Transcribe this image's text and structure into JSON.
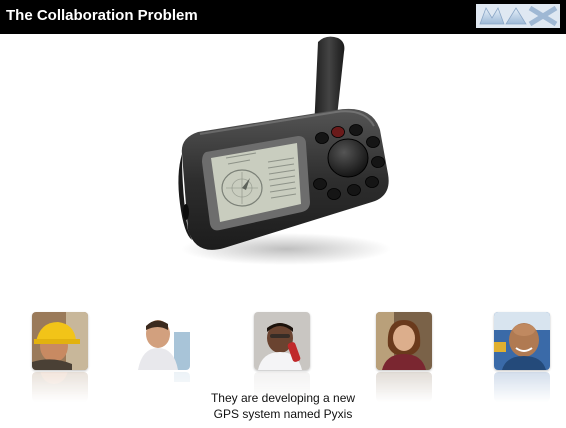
{
  "slide": {
    "title": "The Collaboration Problem",
    "logo_icon": "max-logo",
    "caption": {
      "line1": "They are developing a new",
      "line2": "GPS system named Pyxis"
    },
    "people_icons": [
      "worker-hardhat-photo",
      "man-smiling-photo",
      "man-phone-photo",
      "woman-photo",
      "man-bald-photo"
    ]
  },
  "colors": {
    "title_bar": "#000000",
    "title_text": "#ffffff",
    "background": "#ffffff",
    "gps_body": "#3a3a3a",
    "gps_screen": "#c9cdbf"
  }
}
